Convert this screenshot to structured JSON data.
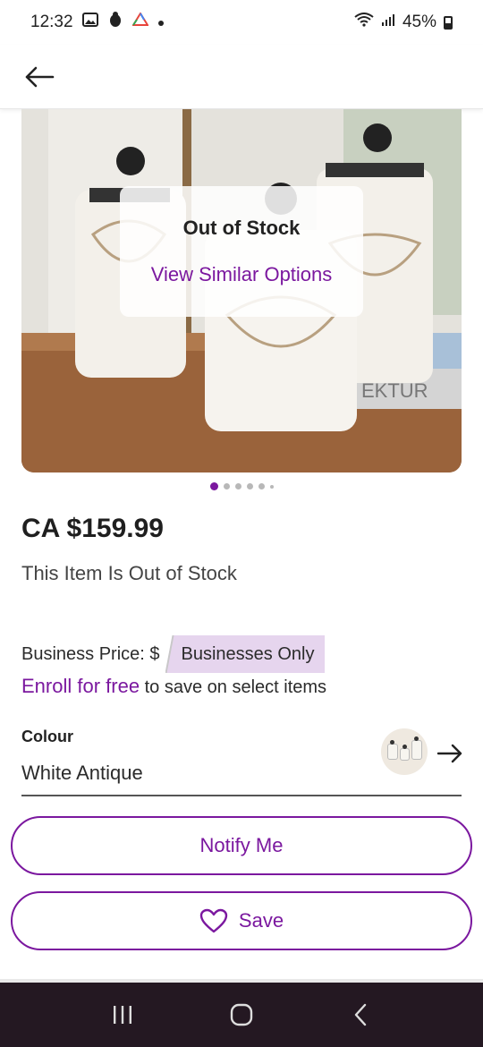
{
  "status_bar": {
    "time": "12:32",
    "battery": "45%",
    "icons": [
      "image-icon",
      "bug-icon",
      "drive-icon",
      "dot-icon",
      "wifi-icon",
      "signal-icon",
      "battery-icon"
    ]
  },
  "app_bar": {
    "back_icon": "arrow-left-icon"
  },
  "hero": {
    "overlay_title": "Out of Stock",
    "overlay_link": "View Similar Options",
    "carousel_dots": 6,
    "active_dot": 0
  },
  "product": {
    "price": "CA $159.99",
    "stock_message": "This Item Is Out of Stock"
  },
  "business": {
    "price_label": "Business Price: $",
    "badge": "Businesses Only",
    "enroll_link": "Enroll for free",
    "enroll_text": " to save on select items"
  },
  "colour": {
    "label": "Colour",
    "value": "White Antique"
  },
  "actions": {
    "notify_label": "Notify Me",
    "save_label": "Save"
  },
  "nav": {
    "icons": [
      "recent-apps-icon",
      "home-icon",
      "back-icon"
    ]
  },
  "colors": {
    "accent": "#7b189f",
    "badge_bg": "#e6d5ee",
    "nav_bg": "#241822"
  }
}
